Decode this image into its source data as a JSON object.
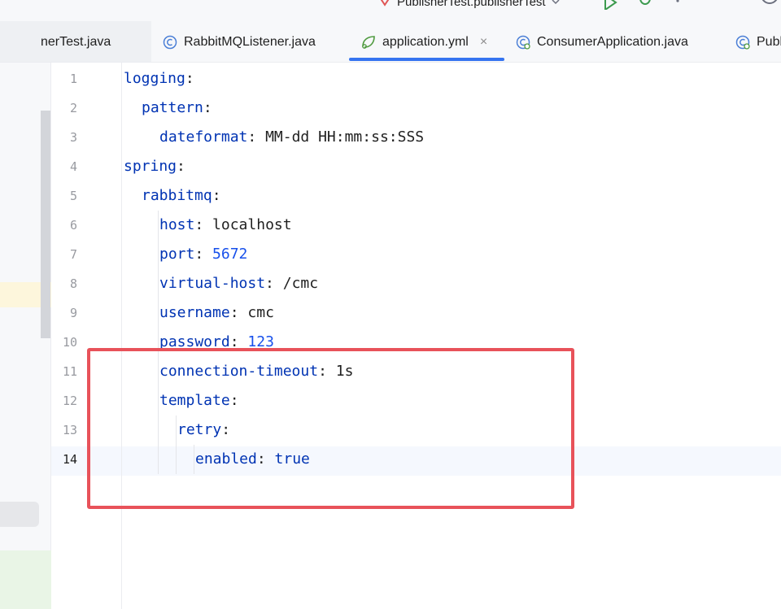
{
  "toolbar": {
    "run_config": "PublisherTest.publisherTest"
  },
  "tabs": [
    {
      "label": "nerTest.java",
      "active": false,
      "icon": "java-class-icon"
    },
    {
      "label": "RabbitMQListener.java",
      "active": false,
      "icon": "java-class-icon"
    },
    {
      "label": "application.yml",
      "active": true,
      "icon": "spring-yaml-icon",
      "close": "×"
    },
    {
      "label": "ConsumerApplication.java",
      "active": false,
      "icon": "spring-boot-class-icon"
    },
    {
      "label": "Publi",
      "active": false,
      "icon": "spring-boot-class-icon"
    }
  ],
  "editor": {
    "current_line": 14,
    "lines": [
      {
        "num": "1",
        "indent": 0,
        "key": "logging",
        "value": ""
      },
      {
        "num": "2",
        "indent": 1,
        "key": "pattern",
        "value": ""
      },
      {
        "num": "3",
        "indent": 2,
        "key": "dateformat",
        "value": "MM-dd HH:mm:ss:SSS"
      },
      {
        "num": "4",
        "indent": 0,
        "key": "spring",
        "value": ""
      },
      {
        "num": "5",
        "indent": 1,
        "key": "rabbitmq",
        "value": ""
      },
      {
        "num": "6",
        "indent": 2,
        "key": "host",
        "value": "localhost"
      },
      {
        "num": "7",
        "indent": 2,
        "key": "port",
        "value": "5672"
      },
      {
        "num": "8",
        "indent": 2,
        "key": "virtual-host",
        "value": "/cmc"
      },
      {
        "num": "9",
        "indent": 2,
        "key": "username",
        "value": "cmc"
      },
      {
        "num": "10",
        "indent": 2,
        "key": "password",
        "value": "123"
      },
      {
        "num": "11",
        "indent": 2,
        "key": "connection-timeout",
        "value": "1s"
      },
      {
        "num": "12",
        "indent": 2,
        "key": "template",
        "value": ""
      },
      {
        "num": "13",
        "indent": 3,
        "key": "retry",
        "value": ""
      },
      {
        "num": "14",
        "indent": 4,
        "key": "enabled",
        "value": "true"
      }
    ]
  },
  "colors": {
    "key": "#0033b3",
    "number": "#1750eb",
    "accent": "#3574f0",
    "annotation": "#e8525a"
  }
}
